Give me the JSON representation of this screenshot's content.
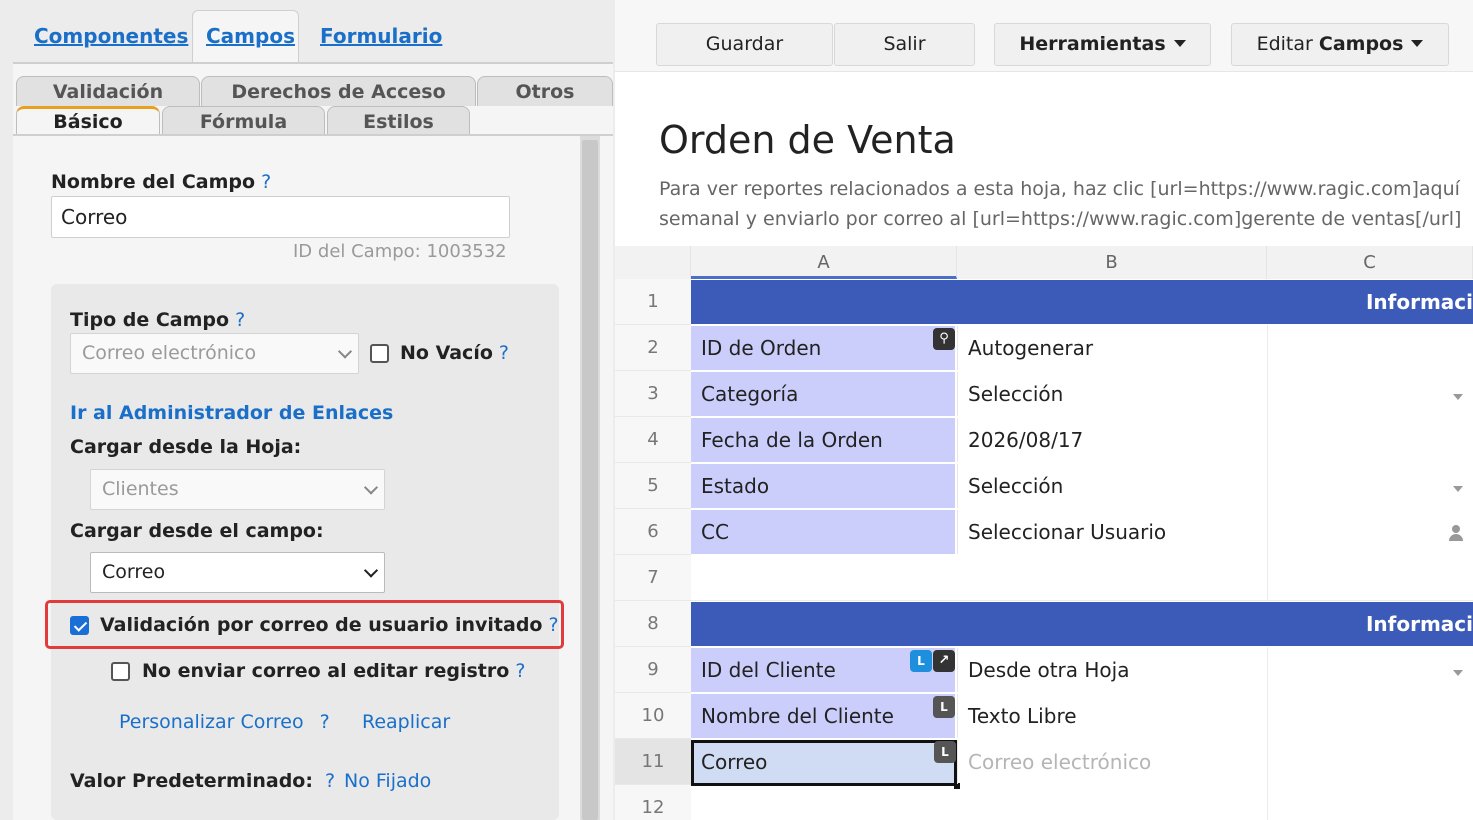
{
  "left_panel": {
    "top_tabs": [
      "Componentes",
      "Campos",
      "Formulario"
    ],
    "sub_tabs_row1": [
      "Validación",
      "Derechos de Acceso",
      "Otros"
    ],
    "sub_tabs_row2": [
      "Básico",
      "Fórmula",
      "Estilos"
    ],
    "field_name_label": "Nombre del Campo",
    "help": "?",
    "field_name_value": "Correo",
    "field_id": "ID del Campo: 1003532",
    "field_type_label": "Tipo de Campo",
    "field_type_value": "Correo electrónico",
    "not_empty_label": "No Vacío",
    "link_manager": "Ir al Administrador de Enlaces",
    "load_from_sheet_label": "Cargar desde la Hoja:",
    "load_from_sheet_value": "Clientes",
    "load_from_field_label": "Cargar desde el campo:",
    "load_from_field_value": "Correo",
    "guest_validation_label": "Validación por correo de usuario invitado",
    "guest_validation_checked": true,
    "no_send_label": "No enviar correo al editar registro",
    "no_send_checked": false,
    "customize_email": "Personalizar Correo",
    "reapply": "Reaplicar",
    "default_value_label": "Valor Predeterminado:",
    "default_value_link": "No Fijado"
  },
  "toolbar": {
    "save": "Guardar",
    "exit": "Salir",
    "tools": "Herramientas",
    "edit_prefix": "Editar",
    "edit_bold": "Campos"
  },
  "sheet": {
    "title": "Orden de Venta",
    "desc_line1": "Para ver reportes relacionados a esta hoja, haz clic [url=https://www.ragic.com]aquí",
    "desc_line2": "semanal y enviarlo por correo al [url=https://www.ragic.com]gerente de ventas[/url]",
    "columns": [
      "A",
      "B",
      "C"
    ],
    "row_numbers": [
      "1",
      "2",
      "3",
      "4",
      "5",
      "6",
      "7",
      "8",
      "9",
      "10",
      "11",
      "12"
    ],
    "section1": "Informaci",
    "section2": "Informaci",
    "rows": [
      {
        "label": "ID de Orden",
        "value": "Autogenerar"
      },
      {
        "label": "Categoría",
        "value": "Selección"
      },
      {
        "label": "Fecha de la Orden",
        "value": "2026/08/17"
      },
      {
        "label": "Estado",
        "value": "Selección"
      },
      {
        "label": "CC",
        "value": "Seleccionar Usuario"
      },
      {
        "label": "ID del Cliente",
        "value": "Desde otra Hoja"
      },
      {
        "label": "Nombre del Cliente",
        "value": "Texto Libre"
      },
      {
        "label": "Correo",
        "value": "Correo electrónico"
      }
    ],
    "badge_l": "L",
    "colors": {
      "header_blue": "#3c5bb8",
      "label_purple": "#cbcdfb",
      "highlight_red": "#e23b3b",
      "link_blue": "#1a6fc9"
    }
  }
}
